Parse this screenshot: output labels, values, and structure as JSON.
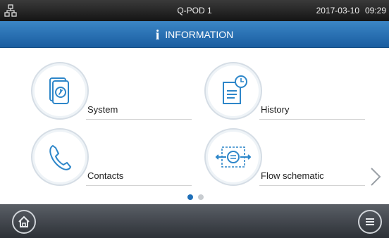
{
  "status_bar": {
    "device_name": "Q-POD 1",
    "date": "2017-03-10",
    "time": "09:29",
    "network_icon": "network-icon"
  },
  "header": {
    "icon": "info-icon",
    "icon_glyph": "i",
    "title": "INFORMATION"
  },
  "tiles": [
    {
      "label": "System",
      "icon": "system-icon"
    },
    {
      "label": "History",
      "icon": "history-icon"
    },
    {
      "label": "Contacts",
      "icon": "phone-icon"
    },
    {
      "label": "Flow schematic",
      "icon": "flow-schematic-icon"
    }
  ],
  "pagination": {
    "current_page": 1,
    "total_pages": 2
  },
  "footer": {
    "left": "home-icon",
    "right": "menu-icon"
  },
  "colors": {
    "accent": "#1f6fb5",
    "dot_active": "#1e6fb8",
    "dot_inactive": "#c8ccd0",
    "footer": "#3a3f45"
  }
}
